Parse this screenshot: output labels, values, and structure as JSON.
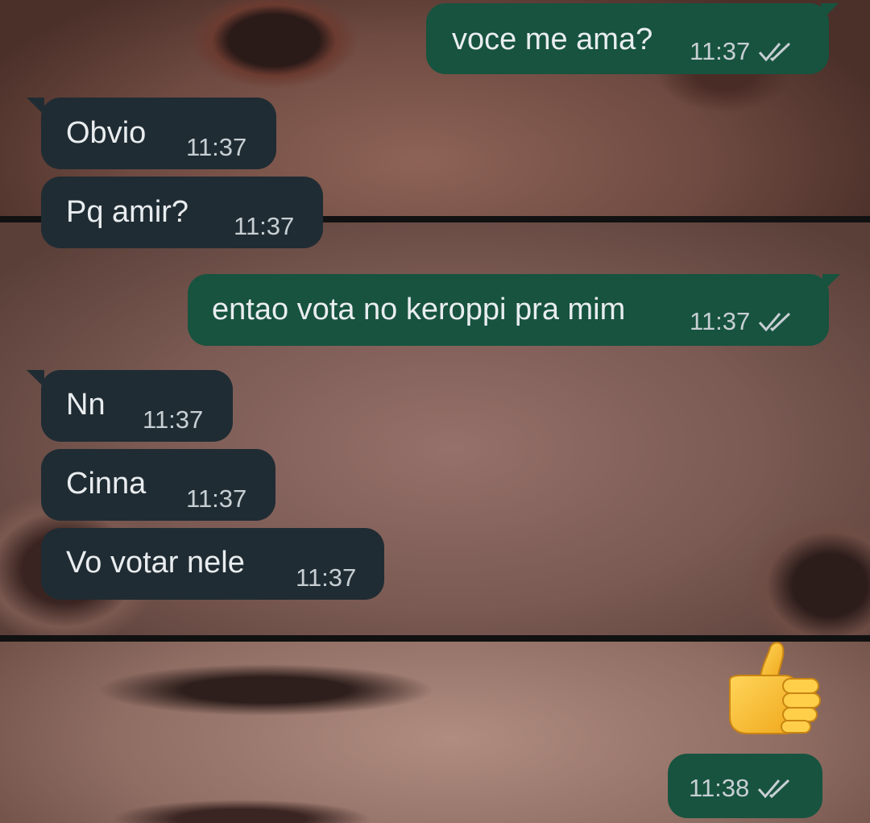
{
  "messages": [
    {
      "id": "m1",
      "direction": "outgoing",
      "text": "voce me ama?",
      "time": "11:37",
      "status": "read"
    },
    {
      "id": "m2",
      "direction": "incoming",
      "text": "Obvio",
      "time": "11:37"
    },
    {
      "id": "m3",
      "direction": "incoming",
      "text": "Pq amir?",
      "time": "11:37"
    },
    {
      "id": "m4",
      "direction": "outgoing",
      "text": "entao vota no keroppi pra mim",
      "time": "11:37",
      "status": "read"
    },
    {
      "id": "m5",
      "direction": "incoming",
      "text": "Nn",
      "time": "11:37"
    },
    {
      "id": "m6",
      "direction": "incoming",
      "text": "Cinna",
      "time": "11:37"
    },
    {
      "id": "m7",
      "direction": "incoming",
      "text": "Vo votar nele",
      "time": "11:37"
    },
    {
      "id": "m8",
      "direction": "outgoing",
      "emoji": "thumbs-up-emoji",
      "time": "11:38",
      "status": "read"
    }
  ],
  "colors": {
    "incoming_bubble": "#202c33",
    "outgoing_bubble": "#17533f",
    "text": "#e9edef",
    "meta_text": "#c7cfd3",
    "read_ticks": "#c7cfd3",
    "emoji_yellow": "#f7b92b"
  },
  "icons": {
    "read_receipt": "double-check-icon"
  }
}
